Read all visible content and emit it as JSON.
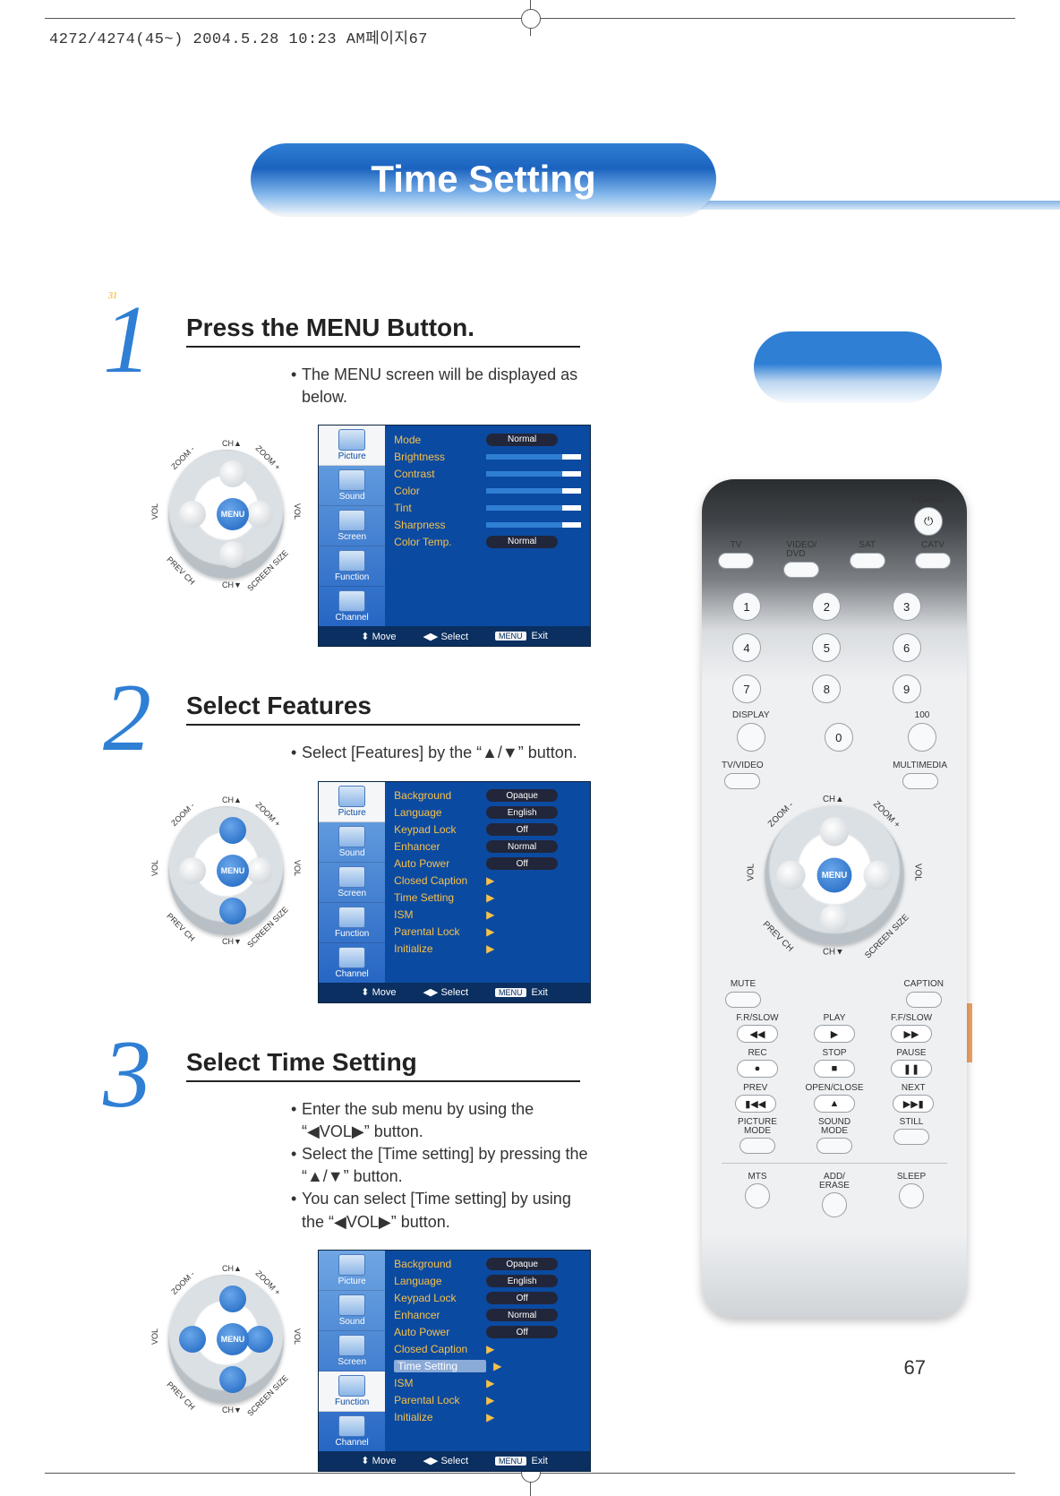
{
  "meta": {
    "header_text": "4272/4274(45~)  2004.5.28 10:23 AM페이지67"
  },
  "title": "Time Setting",
  "page_number": "67",
  "dpad": {
    "ch_up": "CH▲",
    "ch_dn": "CH▼",
    "vol_l": "VOL",
    "vol_r": "VOL",
    "zoom_minus": "ZOOM -",
    "zoom_plus": "ZOOM +",
    "prev_ch": "PREV CH",
    "screen_size": "SCREEN SIZE",
    "menu": "MENU"
  },
  "steps": [
    {
      "n": "1",
      "heading": "Press the MENU Button.",
      "bullets": [
        "The MENU screen will be displayed as below."
      ],
      "osd": {
        "side_selected": 0,
        "side": [
          "Picture",
          "Sound",
          "Screen",
          "Function",
          "Channel"
        ],
        "rows": [
          {
            "k": "Mode",
            "type": "pill",
            "v": "Normal"
          },
          {
            "k": "Brightness",
            "type": "bar",
            "v": "31"
          },
          {
            "k": "Contrast",
            "type": "bar",
            "v": "31"
          },
          {
            "k": "Color",
            "type": "bar",
            "v": "31"
          },
          {
            "k": "Tint",
            "type": "bar",
            "v": "31"
          },
          {
            "k": "Sharpness",
            "type": "bar",
            "v": "31"
          },
          {
            "k": "Color Temp.",
            "type": "pill",
            "v": "Normal"
          }
        ],
        "foot": {
          "move": "Move",
          "select": "Select",
          "menu": "MENU",
          "exit": "Exit"
        }
      }
    },
    {
      "n": "2",
      "heading": "Select Features",
      "bullets": [
        "Select [Features] by the “▲/▼” button."
      ],
      "dpad_blue": "vert",
      "osd": {
        "side_selected": 0,
        "side": [
          "Picture",
          "Sound",
          "Screen",
          "Function",
          "Channel"
        ],
        "rows": [
          {
            "k": "Background",
            "type": "pill",
            "v": "Opaque"
          },
          {
            "k": "Language",
            "type": "pill",
            "v": "English"
          },
          {
            "k": "Keypad Lock",
            "type": "pill",
            "v": "Off"
          },
          {
            "k": "Enhancer",
            "type": "pill",
            "v": "Normal"
          },
          {
            "k": "Auto Power",
            "type": "pill",
            "v": "Off"
          },
          {
            "k": "Closed Caption",
            "type": "sub"
          },
          {
            "k": "Time Setting",
            "type": "sub"
          },
          {
            "k": "ISM",
            "type": "sub"
          },
          {
            "k": "Parental Lock",
            "type": "sub"
          },
          {
            "k": "Initialize",
            "type": "sub"
          }
        ],
        "foot": {
          "move": "Move",
          "select": "Select",
          "menu": "MENU",
          "exit": "Exit"
        }
      }
    },
    {
      "n": "3",
      "heading": "Select Time Setting",
      "bullets": [
        "Enter the sub menu by using the “◀VOL▶” button.",
        "Select the [Time setting] by pressing the “▲/▼” button.",
        "You can select [Time setting] by using the  “◀VOL▶” button."
      ],
      "dpad_blue": "all",
      "osd": {
        "side_selected": 3,
        "side": [
          "Picture",
          "Sound",
          "Screen",
          "Function",
          "Channel"
        ],
        "rows": [
          {
            "k": "Background",
            "type": "pill",
            "v": "Opaque"
          },
          {
            "k": "Language",
            "type": "pill",
            "v": "English"
          },
          {
            "k": "Keypad Lock",
            "type": "pill",
            "v": "Off"
          },
          {
            "k": "Enhancer",
            "type": "pill",
            "v": "Normal"
          },
          {
            "k": "Auto Power",
            "type": "pill",
            "v": "Off"
          },
          {
            "k": "Closed Caption",
            "type": "sub"
          },
          {
            "k": "Time Setting",
            "type": "sub",
            "sel": true
          },
          {
            "k": "ISM",
            "type": "sub"
          },
          {
            "k": "Parental Lock",
            "type": "sub"
          },
          {
            "k": "Initialize",
            "type": "sub"
          }
        ],
        "foot": {
          "move": "Move",
          "select": "Select",
          "menu": "MENU",
          "exit": "Exit"
        }
      }
    }
  ],
  "remote": {
    "power": "POWER",
    "src_labels": [
      "TV",
      "VIDEO/\nDVD",
      "SAT",
      "CATV"
    ],
    "keypad": [
      "1",
      "2",
      "3",
      "4",
      "5",
      "6",
      "7",
      "8",
      "9"
    ],
    "keypad_bottom": {
      "display": "DISPLAY",
      "zero": "0",
      "hundred": "100"
    },
    "line_labels": {
      "tvvideo": "TV/VIDEO",
      "multimedia": "MULTIMEDIA"
    },
    "dpad": {
      "ch_up": "CH▲",
      "ch_dn": "CH▼",
      "vol": "VOL",
      "zoom_minus": "ZOOM -",
      "zoom_plus": "ZOOM +",
      "prev_ch": "PREV CH",
      "screen_size": "SCREEN SIZE",
      "menu": "MENU"
    },
    "row_a": {
      "mute": "MUTE",
      "caption": "CAPTION"
    },
    "row_b": {
      "frs": "F.R/SLOW",
      "play": "PLAY",
      "ffs": "F.F/SLOW"
    },
    "row_b_icons": [
      "◀◀",
      "▶",
      "▶▶"
    ],
    "row_c": {
      "rec": "REC",
      "stop": "STOP",
      "pause": "PAUSE"
    },
    "row_c_icons": [
      "●",
      "■",
      "❚❚"
    ],
    "row_d": {
      "prev": "PREV",
      "open": "OPEN/CLOSE",
      "next": "NEXT"
    },
    "row_d_icons": [
      "▮◀◀",
      "▲",
      "▶▶▮"
    ],
    "row_e": {
      "picmode": "PICTURE\nMODE",
      "sndmode": "SOUND\nMODE",
      "still": "STILL"
    },
    "row_f": {
      "mts": "MTS",
      "adderase": "ADD/\nERASE",
      "sleep": "SLEEP"
    }
  }
}
